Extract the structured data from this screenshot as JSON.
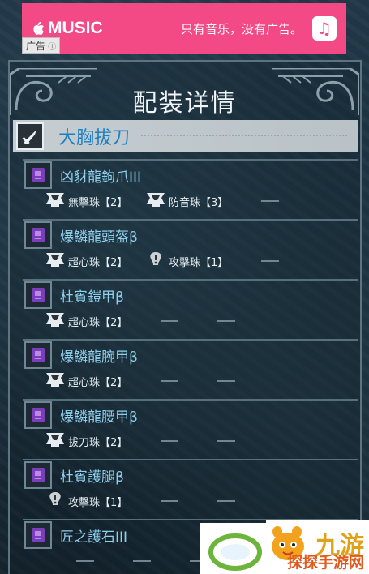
{
  "ad": {
    "brand": "MUSIC",
    "slogan": "只有音乐，没有广告。",
    "tag": "广告",
    "colors": {
      "background": "#f34a86"
    }
  },
  "page": {
    "title": "配装详情"
  },
  "weapon": {
    "name": "大胸拔刀",
    "icon": "great-sword-icon"
  },
  "items": [
    {
      "name": "凶豺龍鉤爪III",
      "icon": "weapon-claw-icon",
      "slots": [
        {
          "label": "無擊珠【2】",
          "level": 2
        },
        {
          "label": "防音珠【3】",
          "level": 3
        }
      ]
    },
    {
      "name": "爆鱗龍頭盔β",
      "icon": "helm-icon",
      "slots": [
        {
          "label": "超心珠【2】",
          "level": 2
        },
        {
          "label": "攻擊珠【1】",
          "level": 1
        }
      ]
    },
    {
      "name": "杜賓鎧甲β",
      "icon": "chest-icon",
      "slots": [
        {
          "label": "超心珠【2】",
          "level": 2
        }
      ]
    },
    {
      "name": "爆鱗龍腕甲β",
      "icon": "arms-icon",
      "slots": [
        {
          "label": "超心珠【2】",
          "level": 2
        }
      ]
    },
    {
      "name": "爆鱗龍腰甲β",
      "icon": "waist-icon",
      "slots": [
        {
          "label": "拔刀珠【2】",
          "level": 2
        }
      ]
    },
    {
      "name": "杜賓護腿β",
      "icon": "legs-icon",
      "slots": [
        {
          "label": "攻擊珠【1】",
          "level": 1
        }
      ]
    },
    {
      "name": "匠之護石III",
      "icon": "charm-icon",
      "slots": []
    }
  ],
  "watermark": {
    "line1": "九游",
    "line2": "探探手游网"
  }
}
